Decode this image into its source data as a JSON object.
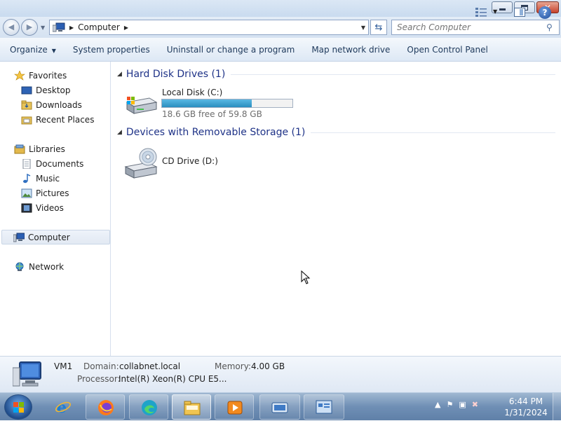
{
  "window": {
    "buttons": {
      "minimize": "minimize",
      "maximize": "maximize",
      "close": "close"
    }
  },
  "address": {
    "breadcrumb": "Computer",
    "search_placeholder": "Search Computer"
  },
  "commands": {
    "organize": "Organize",
    "system_properties": "System properties",
    "uninstall": "Uninstall or change a program",
    "map_drive": "Map network drive",
    "control_panel": "Open Control Panel"
  },
  "nav": {
    "favorites": "Favorites",
    "desktop": "Desktop",
    "downloads": "Downloads",
    "recent": "Recent Places",
    "libraries": "Libraries",
    "documents": "Documents",
    "music": "Music",
    "pictures": "Pictures",
    "videos": "Videos",
    "computer": "Computer",
    "network": "Network"
  },
  "content": {
    "hdd_group": "Hard Disk Drives (1)",
    "local_disk": {
      "name": "Local Disk (C:)",
      "free": "18.6 GB free of 59.8 GB",
      "used_fraction": 0.689
    },
    "removable_group": "Devices with Removable Storage (1)",
    "cd_drive": {
      "name": "CD Drive (D:)"
    }
  },
  "details": {
    "name": "VM1",
    "domain_label": "Domain:",
    "domain_value": "collabnet.local",
    "memory_label": "Memory:",
    "memory_value": "4.00 GB",
    "processor_label": "Processor:",
    "processor_value": "Intel(R) Xeon(R) CPU E5..."
  },
  "taskbar": {
    "time": "6:44 PM",
    "date": "1/31/2024"
  }
}
